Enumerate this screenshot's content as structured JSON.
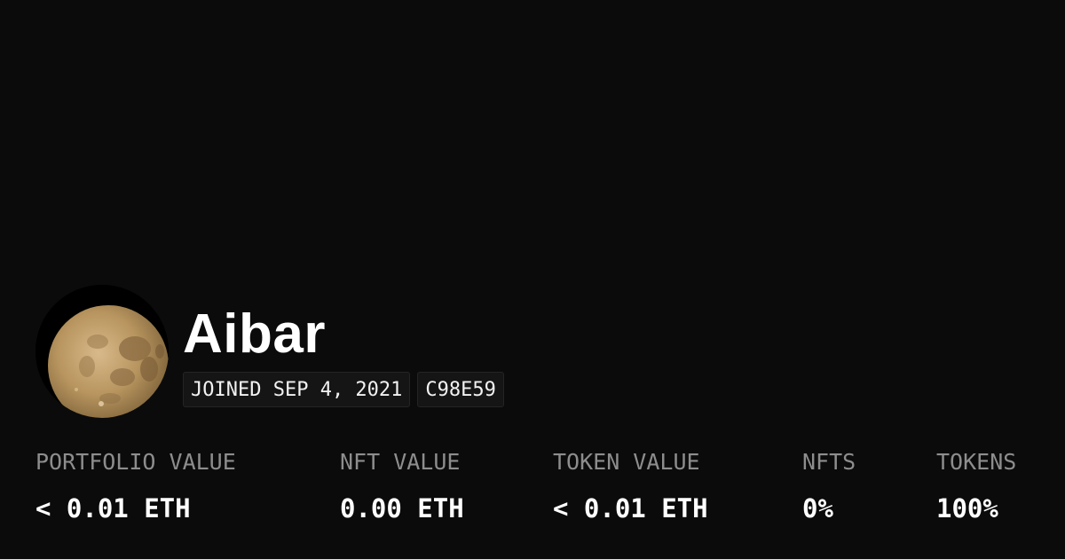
{
  "profile": {
    "name": "Aibar",
    "joined": "JOINED SEP 4, 2021",
    "address_tag": "C98E59"
  },
  "stats": [
    {
      "label": "PORTFOLIO VALUE",
      "value": "< 0.01 ETH"
    },
    {
      "label": "NFT VALUE",
      "value": "0.00 ETH"
    },
    {
      "label": "TOKEN VALUE",
      "value": "< 0.01 ETH"
    },
    {
      "label": "NFTS",
      "value": "0%"
    },
    {
      "label": "TOKENS",
      "value": "100%"
    }
  ],
  "colors": {
    "background": "#0b0b0b",
    "text": "#ffffff",
    "muted": "#8d8d8d",
    "badge_bg": "#151515"
  }
}
